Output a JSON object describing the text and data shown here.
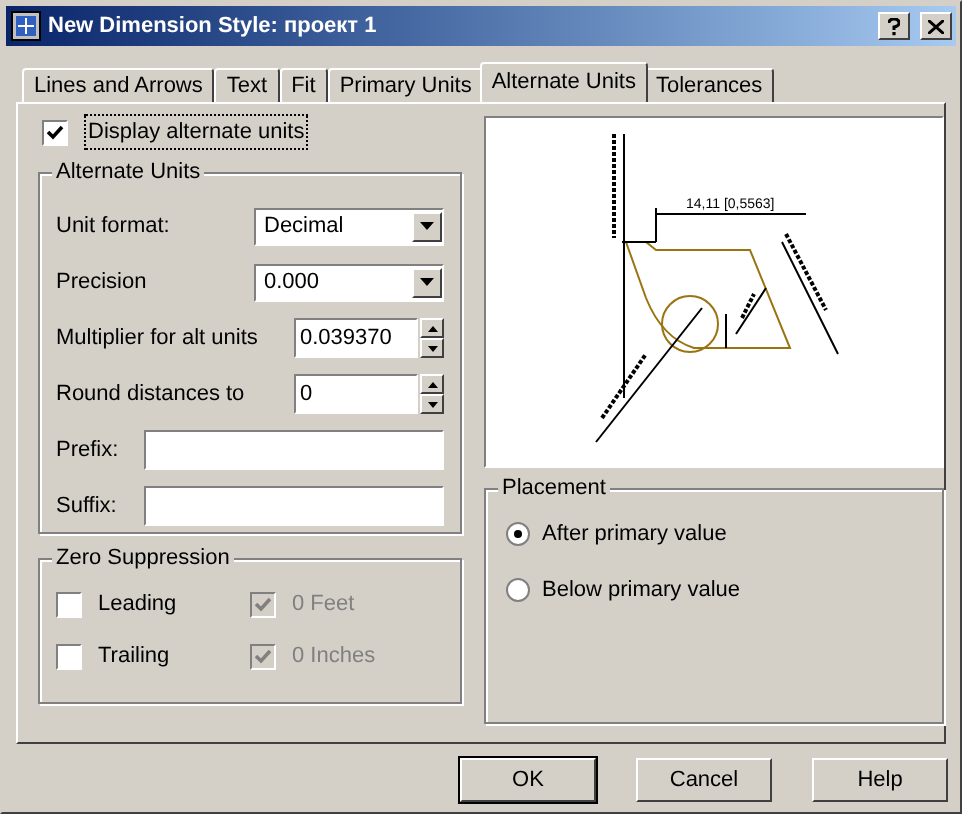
{
  "window": {
    "title": "New Dimension Style: проект 1"
  },
  "tabs": [
    {
      "label": "Lines and Arrows",
      "selected": false
    },
    {
      "label": "Text",
      "selected": false
    },
    {
      "label": "Fit",
      "selected": false
    },
    {
      "label": "Primary Units",
      "selected": false
    },
    {
      "label": "Alternate Units",
      "selected": true
    },
    {
      "label": "Tolerances",
      "selected": false
    }
  ],
  "display_alternate_units": {
    "label": "Display alternate units",
    "checked": true
  },
  "alternate_units": {
    "title": "Alternate Units",
    "fields": [
      {
        "kind": "select",
        "label": "Unit format:",
        "value": "Decimal"
      },
      {
        "kind": "select",
        "label": "Precision",
        "value": "0.000"
      },
      {
        "kind": "spinner",
        "label": "Multiplier for alt units",
        "value": "0.039370"
      },
      {
        "kind": "spinner",
        "label": "Round distances to",
        "value": "0"
      },
      {
        "kind": "text",
        "label": "Prefix:"
      },
      {
        "kind": "text",
        "label": "Suffix:"
      }
    ]
  },
  "zero_suppression": {
    "title": "Zero Suppression",
    "options": [
      {
        "label": "Leading",
        "checked": false,
        "disabled": false
      },
      {
        "label": "0 Feet",
        "checked": true,
        "disabled": true
      },
      {
        "label": "Trailing",
        "checked": false,
        "disabled": false
      },
      {
        "label": "0 Inches",
        "checked": true,
        "disabled": true
      }
    ]
  },
  "preview": {
    "dimension_label": "14,11 [0,5563]"
  },
  "placement": {
    "title": "Placement",
    "options": [
      {
        "label": "After primary value",
        "selected": true
      },
      {
        "label": "Below primary value",
        "selected": false
      }
    ]
  },
  "buttons": [
    {
      "label": "OK",
      "default": true
    },
    {
      "label": "Cancel",
      "default": false
    },
    {
      "label": "Help",
      "default": false
    }
  ]
}
